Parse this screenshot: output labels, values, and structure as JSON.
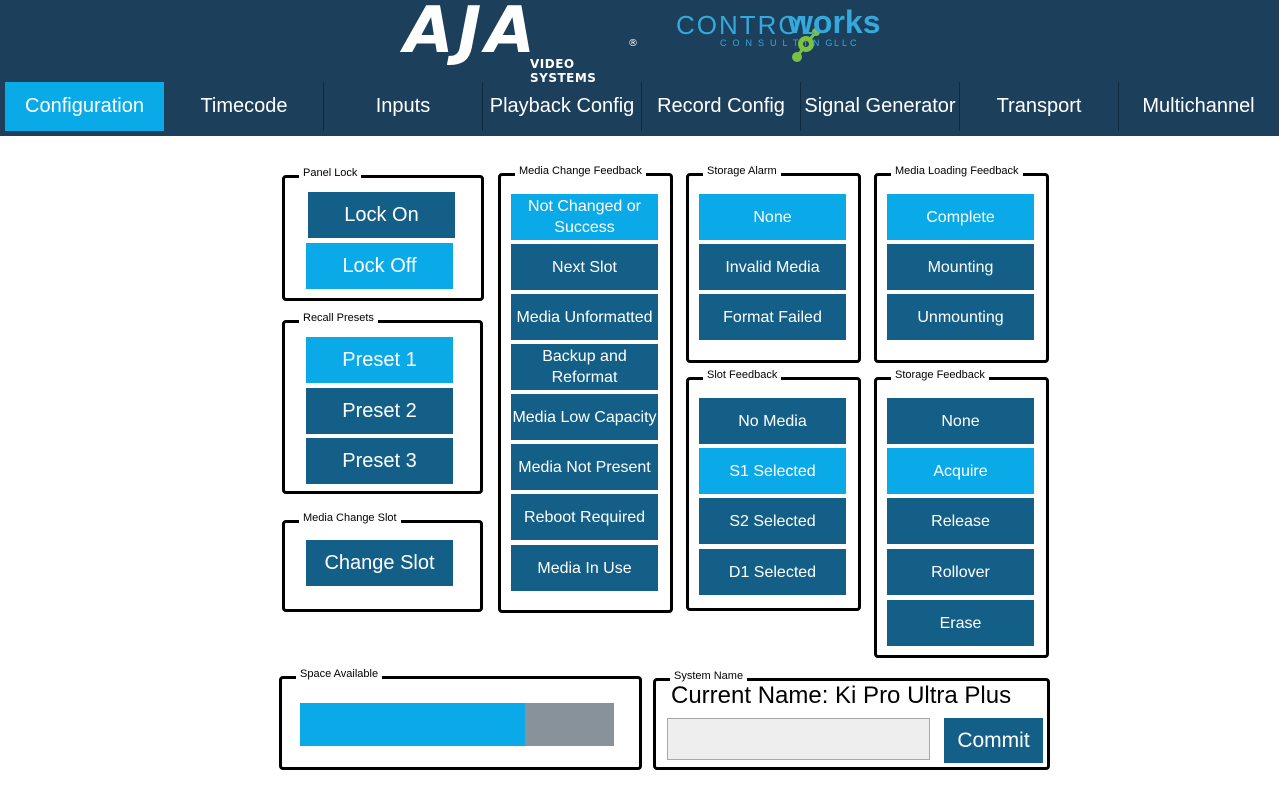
{
  "header": {
    "aja_logo_text": "AJA",
    "aja_registered": "®",
    "aja_subtitle": "VIDEO SYSTEMS",
    "cw_logo_control": "CONTROL",
    "cw_logo_works": "works",
    "cw_logo_consulting": "CONSULTING",
    "cw_logo_llc": "LLC"
  },
  "nav": {
    "tabs": [
      {
        "label": "Configuration",
        "active": true
      },
      {
        "label": "Timecode",
        "active": false
      },
      {
        "label": "Inputs",
        "active": false
      },
      {
        "label": "Playback Config",
        "active": false
      },
      {
        "label": "Record Config",
        "active": false
      },
      {
        "label": "Signal Generator",
        "active": false
      },
      {
        "label": "Transport",
        "active": false
      },
      {
        "label": "Multichannel",
        "active": false
      }
    ]
  },
  "panel_lock": {
    "title": "Panel Lock",
    "buttons": [
      {
        "label": "Lock On",
        "active": false
      },
      {
        "label": "Lock Off",
        "active": true
      }
    ]
  },
  "recall_presets": {
    "title": "Recall Presets",
    "buttons": [
      {
        "label": "Preset 1",
        "active": true
      },
      {
        "label": "Preset 2",
        "active": false
      },
      {
        "label": "Preset 3",
        "active": false
      }
    ]
  },
  "media_change_slot": {
    "title": "Media Change Slot",
    "buttons": [
      {
        "label": "Change Slot",
        "active": false
      }
    ]
  },
  "media_change_feedback": {
    "title": "Media Change Feedback",
    "buttons": [
      {
        "label": "Not Changed or Success",
        "active": true
      },
      {
        "label": "Next Slot",
        "active": false
      },
      {
        "label": "Media Unformatted",
        "active": false
      },
      {
        "label": "Backup and Reformat",
        "active": false
      },
      {
        "label": "Media Low Capacity",
        "active": false
      },
      {
        "label": "Media Not Present",
        "active": false
      },
      {
        "label": "Reboot Required",
        "active": false
      },
      {
        "label": "Media In Use",
        "active": false
      }
    ]
  },
  "storage_alarm": {
    "title": "Storage Alarm",
    "buttons": [
      {
        "label": "None",
        "active": true
      },
      {
        "label": "Invalid Media",
        "active": false
      },
      {
        "label": "Format Failed",
        "active": false
      }
    ]
  },
  "slot_feedback": {
    "title": "Slot Feedback",
    "buttons": [
      {
        "label": "No Media",
        "active": false
      },
      {
        "label": "S1 Selected",
        "active": true
      },
      {
        "label": "S2 Selected",
        "active": false
      },
      {
        "label": "D1 Selected",
        "active": false
      }
    ]
  },
  "media_loading_feedback": {
    "title": "Media Loading Feedback",
    "buttons": [
      {
        "label": "Complete",
        "active": true
      },
      {
        "label": "Mounting",
        "active": false
      },
      {
        "label": "Unmounting",
        "active": false
      }
    ]
  },
  "storage_feedback": {
    "title": "Storage Feedback",
    "buttons": [
      {
        "label": "None",
        "active": false
      },
      {
        "label": "Acquire",
        "active": true
      },
      {
        "label": "Release",
        "active": false
      },
      {
        "label": "Rollover",
        "active": false
      },
      {
        "label": "Erase",
        "active": false
      }
    ]
  },
  "space_available": {
    "title": "Space Available",
    "fill_fraction": 0.717
  },
  "system_name": {
    "title": "System Name",
    "current_name": "Current Name: Ki Pro Ultra Plus",
    "input_value": "",
    "input_placeholder": "",
    "commit_label": "Commit"
  },
  "colors": {
    "header_bg": "#1c3f5b",
    "button_off": "#145f87",
    "button_on": "#0aaae8",
    "bar_empty": "#87929a"
  }
}
